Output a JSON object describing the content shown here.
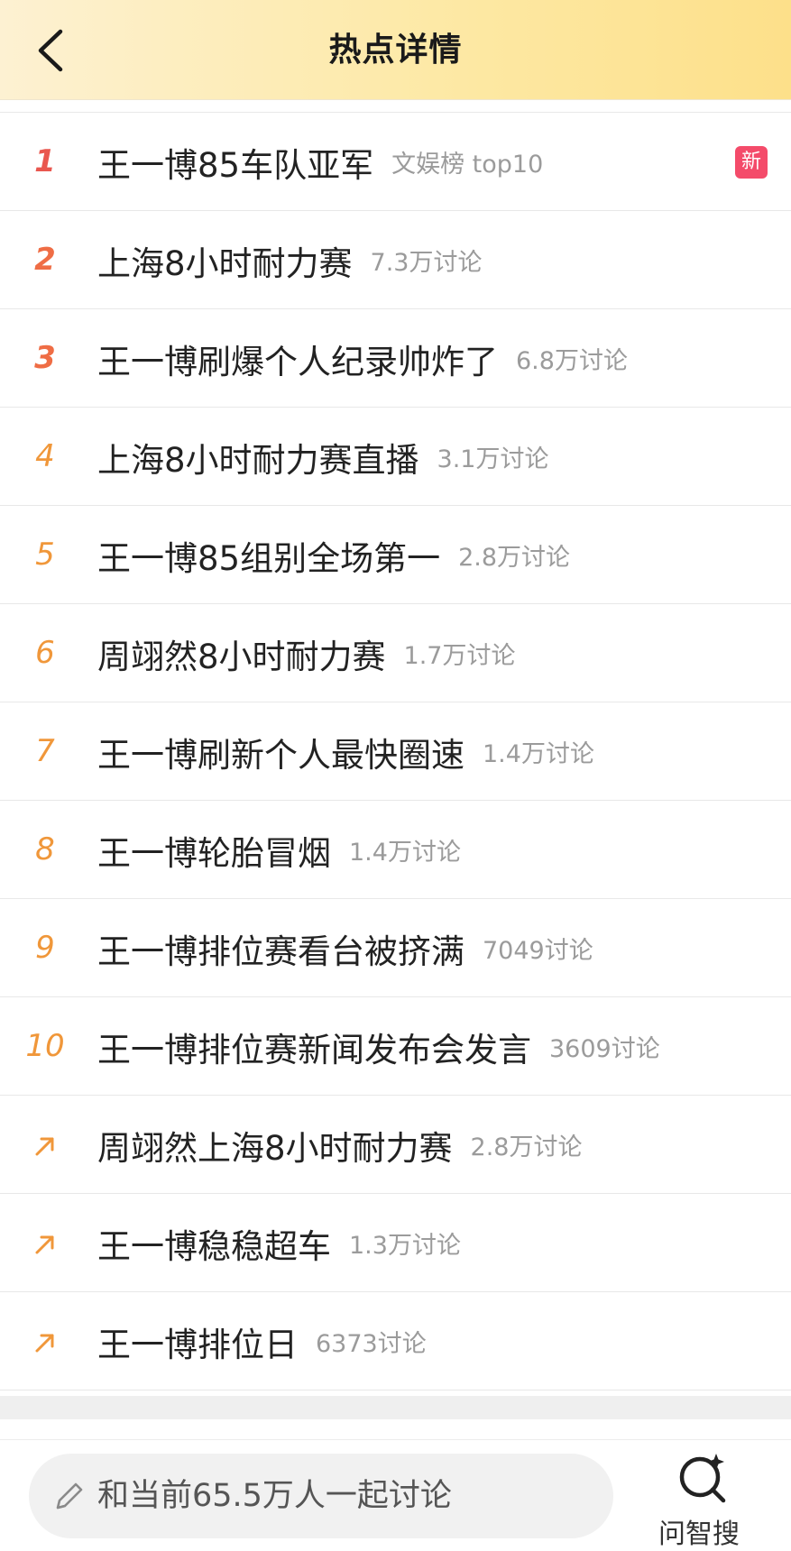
{
  "header": {
    "title": "热点详情",
    "bg_gradient": [
      "#fdf1d2",
      "#fde08a"
    ]
  },
  "list": {
    "items": [
      {
        "rank": "1",
        "rank_type": "number",
        "rank_color": "#e9574f",
        "topic": "王一博85车队亚军",
        "meta": "文娱榜 top10",
        "badge": "新"
      },
      {
        "rank": "2",
        "rank_type": "number",
        "rank_color": "#ef6d45",
        "topic": "上海8小时耐力赛",
        "meta": "7.3万讨论"
      },
      {
        "rank": "3",
        "rank_type": "number",
        "rank_color": "#ef6d45",
        "topic": "王一博刷爆个人纪录帅炸了",
        "meta": "6.8万讨论"
      },
      {
        "rank": "4",
        "rank_type": "number",
        "rank_color": "#f0973a",
        "topic": "上海8小时耐力赛直播",
        "meta": "3.1万讨论"
      },
      {
        "rank": "5",
        "rank_type": "number",
        "rank_color": "#f0973a",
        "topic": "王一博85组别全场第一",
        "meta": "2.8万讨论"
      },
      {
        "rank": "6",
        "rank_type": "number",
        "rank_color": "#f0973a",
        "topic": "周翊然8小时耐力赛",
        "meta": "1.7万讨论"
      },
      {
        "rank": "7",
        "rank_type": "number",
        "rank_color": "#f0973a",
        "topic": "王一博刷新个人最快圈速",
        "meta": "1.4万讨论"
      },
      {
        "rank": "8",
        "rank_type": "number",
        "rank_color": "#f0973a",
        "topic": "王一博轮胎冒烟",
        "meta": "1.4万讨论"
      },
      {
        "rank": "9",
        "rank_type": "number",
        "rank_color": "#f0973a",
        "topic": "王一博排位赛看台被挤满",
        "meta": "7049讨论"
      },
      {
        "rank": "10",
        "rank_type": "number",
        "rank_color": "#f0973a",
        "topic": "王一博排位赛新闻发布会发言",
        "meta": "3609讨论"
      },
      {
        "rank": "arrow-up-right-icon",
        "rank_type": "arrow",
        "rank_color": "#f0973a",
        "topic": "周翊然上海8小时耐力赛",
        "meta": "2.8万讨论"
      },
      {
        "rank": "arrow-up-right-icon",
        "rank_type": "arrow",
        "rank_color": "#f0973a",
        "topic": "王一博稳稳超车",
        "meta": "1.3万讨论"
      },
      {
        "rank": "arrow-up-right-icon",
        "rank_type": "arrow",
        "rank_color": "#f0973a",
        "topic": "王一博排位日",
        "meta": "6373讨论"
      }
    ]
  },
  "bottom": {
    "discuss_placeholder": "和当前65.5万人一起讨论",
    "zhisou_label": "问智搜"
  },
  "colors": {
    "badge_new": "#f44b6a",
    "divider": "#e8e8e8"
  }
}
